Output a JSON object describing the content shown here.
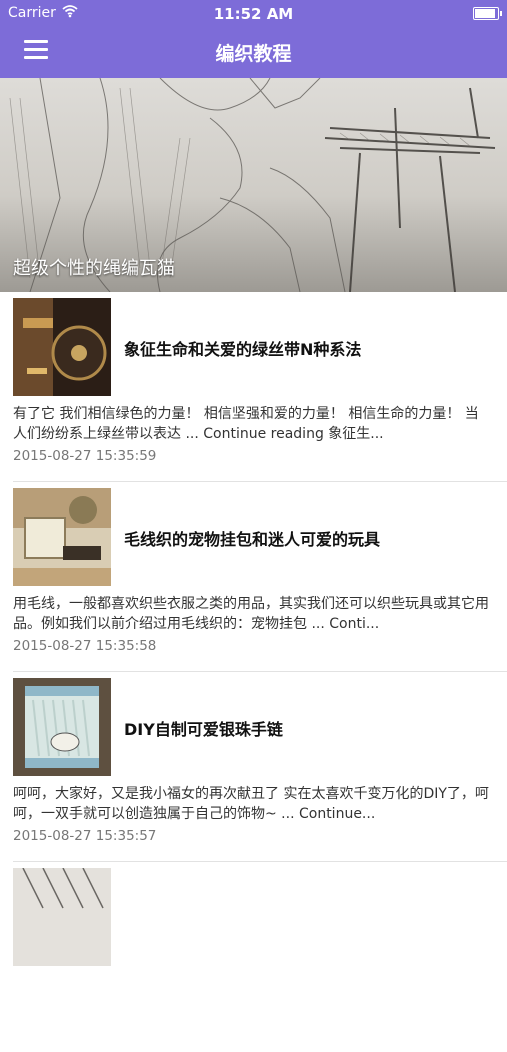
{
  "status_bar": {
    "carrier": "Carrier",
    "time": "11:52 AM"
  },
  "nav": {
    "title": "编织教程"
  },
  "hero": {
    "caption": "超级个性的绳编瓦猫"
  },
  "articles": [
    {
      "title": "象征生命和关爱的绿丝带N种系法",
      "excerpt": "有了它 我们相信绿色的力量！ 相信坚强和爱的力量！ 相信生命的力量！ 当人们纷纷系上绿丝带以表达 ... Continue reading 象征生...",
      "date": "2015-08-27 15:35:59"
    },
    {
      "title": "毛线织的宠物挂包和迷人可爱的玩具",
      "excerpt": "用毛线，一般都喜欢织些衣服之类的用品，其实我们还可以织些玩具或其它用品。例如我们以前介绍过用毛线织的：宠物挂包 ... Conti...",
      "date": "2015-08-27 15:35:58"
    },
    {
      "title": "DIY自制可爱银珠手链",
      "excerpt": "呵呵，大家好，又是我小福女的再次献丑了 实在太喜欢千变万化的DIY了，呵呵，一双手就可以创造独属于自己的饰物~ ... Continue...",
      "date": "2015-08-27 15:35:57"
    }
  ],
  "colors": {
    "accent": "#7d6cd8",
    "date_text": "#777777",
    "divider": "#e2e2e2"
  }
}
